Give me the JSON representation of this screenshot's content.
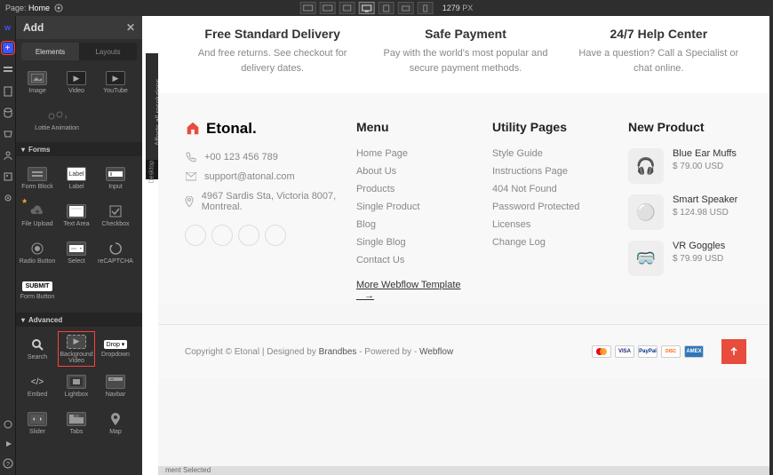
{
  "topbar": {
    "page_label": "Page:",
    "page_name": "Home",
    "px": "1279",
    "px_unit": "PX"
  },
  "panel": {
    "title": "Add",
    "tabs": {
      "elements": "Elements",
      "layouts": "Layouts"
    },
    "media": [
      {
        "label": "Image",
        "name": "image"
      },
      {
        "label": "Video",
        "name": "video"
      },
      {
        "label": "YouTube",
        "name": "youtube"
      },
      {
        "label": "Lottie Animation",
        "name": "lottie-animation"
      }
    ],
    "sec_forms": "Forms",
    "forms": [
      {
        "label": "Form Block",
        "name": "form-block"
      },
      {
        "label": "Label",
        "name": "label"
      },
      {
        "label": "Input",
        "name": "input"
      },
      {
        "label": "File Upload",
        "name": "file-upload",
        "star": true
      },
      {
        "label": "Text Area",
        "name": "text-area"
      },
      {
        "label": "Checkbox",
        "name": "checkbox"
      },
      {
        "label": "Radio Button",
        "name": "radio-button"
      },
      {
        "label": "Select",
        "name": "select"
      },
      {
        "label": "reCAPTCHA",
        "name": "recaptcha"
      },
      {
        "label": "Form Button",
        "name": "form-button",
        "submit": true
      }
    ],
    "sec_adv": "Advanced",
    "adv": [
      {
        "label": "Search",
        "name": "search"
      },
      {
        "label": "Background Video",
        "name": "background-video",
        "highlight": true
      },
      {
        "label": "Dropdown",
        "name": "dropdown",
        "drop": true
      },
      {
        "label": "Embed",
        "name": "embed"
      },
      {
        "label": "Lightbox",
        "name": "lightbox"
      },
      {
        "label": "Navbar",
        "name": "navbar"
      },
      {
        "label": "Slider",
        "name": "slider"
      },
      {
        "label": "Tabs",
        "name": "tabs"
      },
      {
        "label": "Map",
        "name": "map"
      }
    ]
  },
  "desktop_tab": "Affects all resolutions",
  "desktop_lbl": "Desktop",
  "features": [
    {
      "title": "Free Standard Delivery",
      "desc": "And free returns. See checkout for delivery dates."
    },
    {
      "title": "Safe Payment",
      "desc": "Pay with the world's most popular and secure payment methods."
    },
    {
      "title": "24/7 Help Center",
      "desc": "Have a question? Call a Specialist or chat online."
    }
  ],
  "brand": {
    "name": "Etonal.",
    "phone": "+00 123 456 789",
    "email": "support@atonal.com",
    "address": "4967 Sardis Sta, Victoria 8007, Montreal."
  },
  "menu": {
    "title": "Menu",
    "links": [
      "Home Page",
      "About Us",
      "Products",
      "Single Product",
      "Blog",
      "Single Blog",
      "Contact Us"
    ],
    "more": "More Webflow Template"
  },
  "utility": {
    "title": "Utility Pages",
    "links": [
      "Style Guide",
      "Instructions Page",
      "404 Not Found",
      "Password Protected",
      "Licenses",
      "Change Log"
    ]
  },
  "newprod": {
    "title": "New Product",
    "items": [
      {
        "name": "Blue Ear Muffs",
        "price": "$ 79.00 USD",
        "emoji": "🎧"
      },
      {
        "name": "Smart Speaker",
        "price": "$ 124.98 USD",
        "emoji": "⚪"
      },
      {
        "name": "VR Goggles",
        "price": "$ 79.99 USD",
        "emoji": "🥽"
      }
    ]
  },
  "copyright": {
    "text": "Copyright © Etonal | Designed by ",
    "brandbes": "Brandbes",
    "powered": " - Powered by - ",
    "webflow": "Webflow"
  },
  "pay": [
    "MC",
    "VISA",
    "PayPal",
    "DISC",
    "AMEX"
  ],
  "status": "ment Selected"
}
